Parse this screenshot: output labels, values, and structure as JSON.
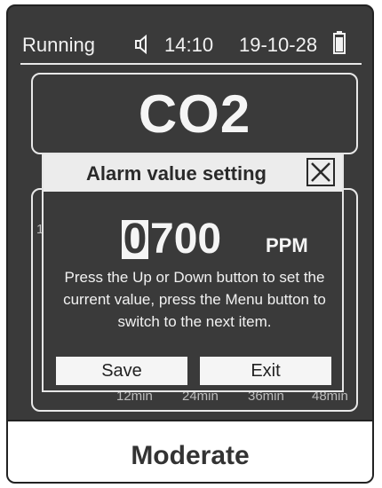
{
  "status": {
    "state": "Running",
    "time": "14:10",
    "date": "19-10-28"
  },
  "gas": {
    "name": "CO2"
  },
  "chart": {
    "y_tick": "1",
    "x_ticks": [
      "12min",
      "24min",
      "36min",
      "48min"
    ]
  },
  "dialog": {
    "title": "Alarm value setting",
    "value_first_digit": "0",
    "value_rest": "700",
    "unit": "PPM",
    "instructions": "Press the Up or Down button to set the current value, press the Menu button to switch to the next item.",
    "save_label": "Save",
    "exit_label": "Exit"
  },
  "footer": {
    "level": "Moderate"
  },
  "colors": {
    "screen_bg": "#3a3a3a",
    "text": "#f2f2f2",
    "panel_border": "#e8e8e8"
  }
}
